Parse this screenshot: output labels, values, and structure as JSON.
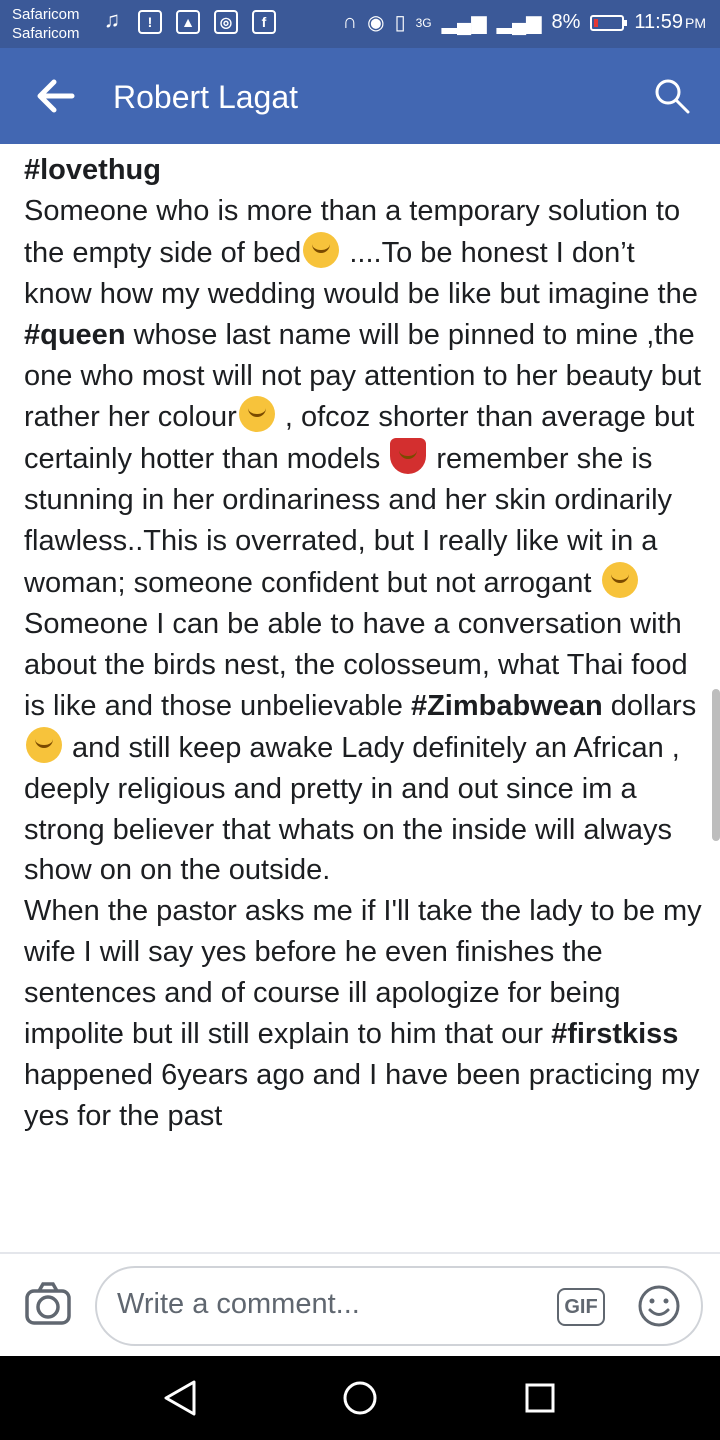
{
  "status_bar": {
    "carrier_1": "Safaricom",
    "carrier_2": "Safaricom",
    "network": "3G",
    "battery": "8%",
    "time": "11:59",
    "am_pm": "PM"
  },
  "header": {
    "title": "Robert Lagat",
    "back_icon": "back-arrow-icon",
    "search_icon": "search-icon"
  },
  "post": {
    "hashtag_1": "#lovethug",
    "text_1": "Someone who is more than a temporary solution to the empty side of bed",
    "text_2": " ....To be honest I don’t know how my wedding would be like but imagine the ",
    "hashtag_2": "#queen",
    "text_3": "  whose last name will be pinned to mine ,the one who most will not pay attention to her beauty but rather her colour",
    "text_4": " , ofcoz shorter than average but certainly hotter than models ",
    "text_5": " remember she is stunning in her ordinariness and  her skin ordinarily flawless..This is overrated, but I really like wit in a woman; someone confident but not arrogant ",
    "text_6": "Someone I can be able to have a conversation with about the birds nest, the colosseum, what Thai food is like and those unbelievable ",
    "hashtag_3": "#Zimbabwean",
    "text_7": " dollars",
    "text_8": " and still keep awake Lady definitely an African , deeply religious and pretty in and out since im a strong believer that whats on the inside will always show on on the outside.",
    "text_9": "When the pastor asks me if I'll take the lady to be my wife I will say yes before he even finishes  the sentences and of course ill apologize for being impolite but ill still explain to him that our ",
    "hashtag_4": "#firstkiss",
    "text_10": " happened 6years ago and I have been practicing my yes for the past"
  },
  "comment_bar": {
    "placeholder": "Write a comment...",
    "gif_label": "GIF"
  }
}
